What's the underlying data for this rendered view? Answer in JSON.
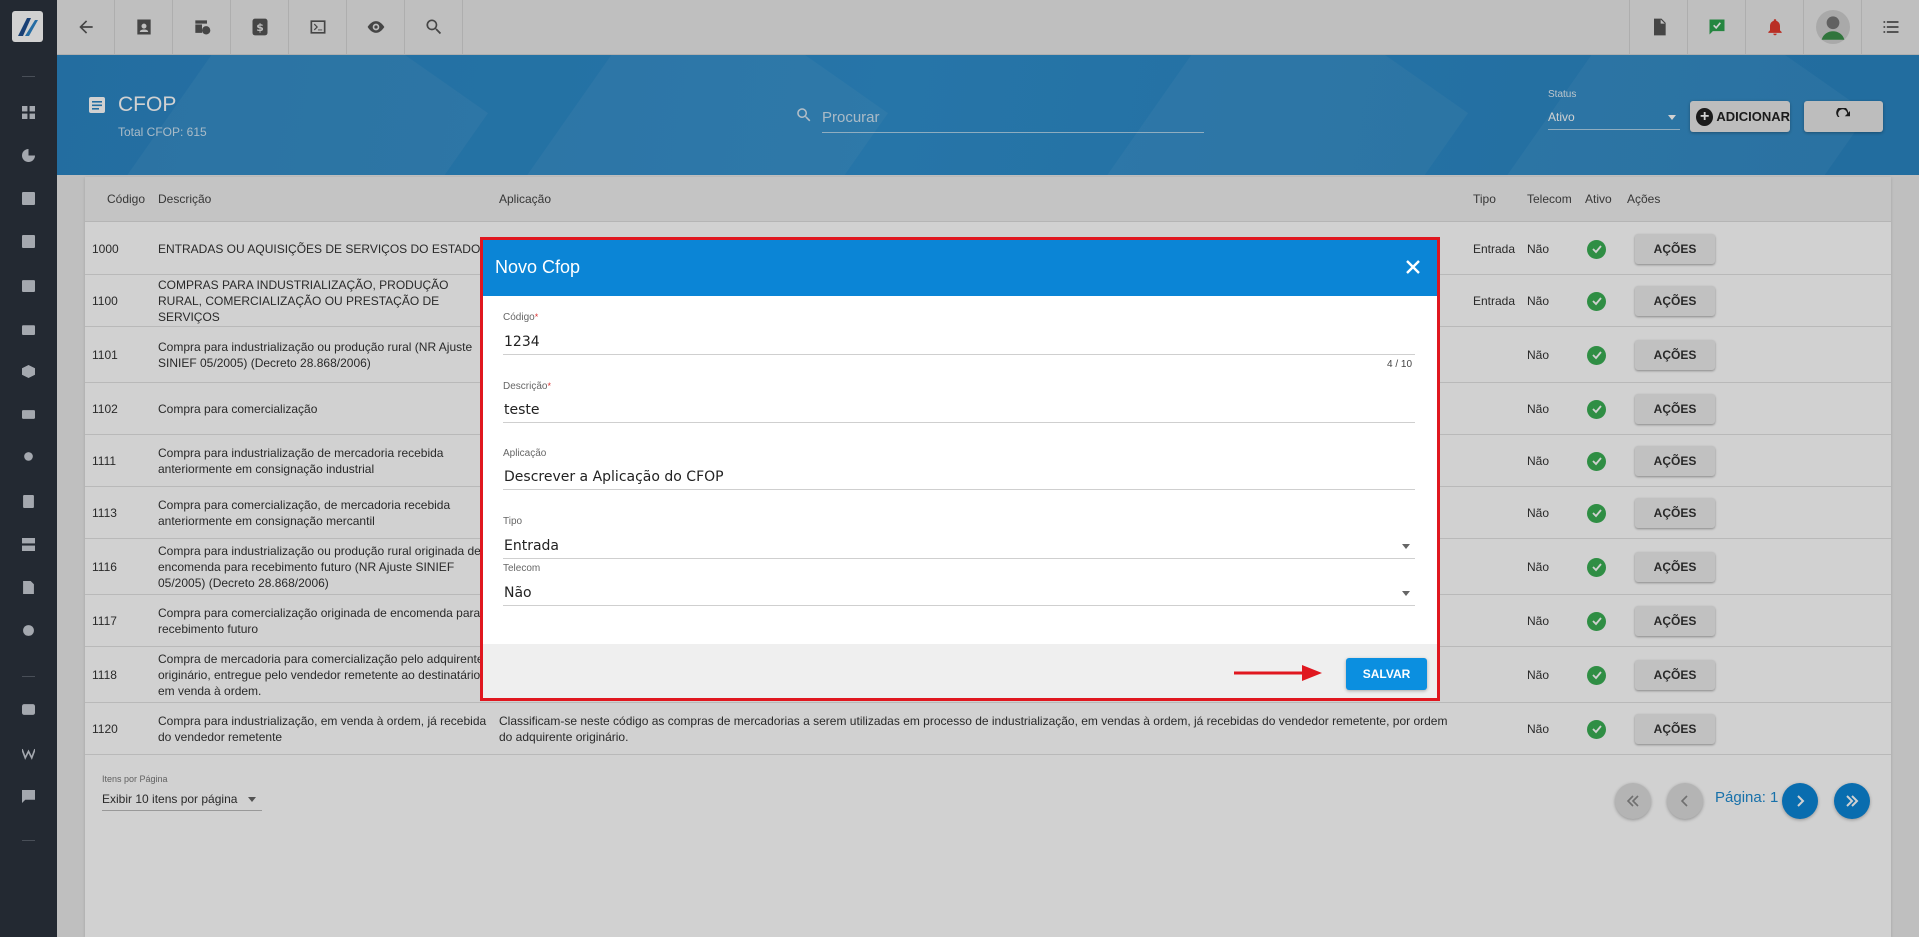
{
  "header": {
    "title": "CFOP",
    "subtitle": "Total CFOP: 615",
    "search_placeholder": "Procurar",
    "status_label": "Status",
    "status_value": "Ativo",
    "add_label": "ADICIONAR"
  },
  "table": {
    "columns": [
      "Código",
      "Descrição",
      "Aplicação",
      "Tipo",
      "Telecom",
      "Ativo",
      "Ações"
    ],
    "rows": [
      {
        "codigo": "1000",
        "descricao": "ENTRADAS OU AQUISIÇÕES DE SERVIÇOS DO ESTADO",
        "aplicacao": "",
        "tipo": "Entrada",
        "telecom": "Não",
        "acoes": "AÇÕES"
      },
      {
        "codigo": "1100",
        "descricao": "COMPRAS PARA INDUSTRIALIZAÇÃO, PRODUÇÃO RURAL, COMERCIALIZAÇÃO OU PRESTAÇÃO DE SERVIÇOS",
        "aplicacao": "",
        "tipo": "Entrada",
        "telecom": "Não",
        "acoes": "AÇÕES"
      },
      {
        "codigo": "1101",
        "descricao": "Compra para industrialização ou produção rural (NR Ajuste SINIEF 05/2005) (Decreto 28.868/2006)",
        "aplicacao": "",
        "tipo": "",
        "telecom": "Não",
        "acoes": "AÇÕES"
      },
      {
        "codigo": "1102",
        "descricao": "Compra para comercialização",
        "aplicacao": "",
        "tipo": "",
        "telecom": "Não",
        "acoes": "AÇÕES"
      },
      {
        "codigo": "1111",
        "descricao": "Compra para industrialização de mercadoria recebida anteriormente em consignação industrial",
        "aplicacao": "",
        "tipo": "",
        "telecom": "Não",
        "acoes": "AÇÕES"
      },
      {
        "codigo": "1113",
        "descricao": "Compra para comercialização, de mercadoria recebida anteriormente em consignação mercantil",
        "aplicacao": "",
        "tipo": "",
        "telecom": "Não",
        "acoes": "AÇÕES"
      },
      {
        "codigo": "1116",
        "descricao": "Compra para industrialização ou produção rural originada de encomenda para recebimento futuro (NR Ajuste SINIEF 05/2005) (Decreto 28.868/2006)",
        "aplicacao": "",
        "tipo": "",
        "telecom": "Não",
        "acoes": "AÇÕES"
      },
      {
        "codigo": "1117",
        "descricao": "Compra para comercialização originada de encomenda para recebimento futuro",
        "aplicacao": "",
        "tipo": "",
        "telecom": "Não",
        "acoes": "AÇÕES"
      },
      {
        "codigo": "1118",
        "descricao": "Compra de mercadoria para comercialização pelo adquirente originário, entregue pelo vendedor remetente ao destinatário, em venda à ordem.",
        "aplicacao": "",
        "tipo": "",
        "telecom": "Não",
        "acoes": "AÇÕES"
      },
      {
        "codigo": "1120",
        "descricao": "Compra para industrialização, em venda à ordem, já recebida do vendedor remetente",
        "aplicacao": "Classificam-se neste código as compras de mercadorias a serem utilizadas em processo de industrialização, em vendas à ordem, já recebidas do vendedor remetente, por ordem do adquirente originário.",
        "tipo": "",
        "telecom": "Não",
        "acoes": "AÇÕES"
      }
    ]
  },
  "pagination": {
    "items_label": "Itens por Página",
    "items_value": "Exibir 10 itens por página",
    "page_label": "Página: 1"
  },
  "modal": {
    "title": "Novo Cfop",
    "codigo_label": "Código",
    "codigo_value": "1234",
    "codigo_counter": "4 / 10",
    "descricao_label": "Descrição",
    "descricao_value": "teste",
    "aplicacao_label": "Aplicação",
    "aplicacao_value": "Descrever a Aplicação do CFOP",
    "tipo_label": "Tipo",
    "tipo_value": "Entrada",
    "telecom_label": "Telecom",
    "telecom_value": "Não",
    "save_label": "SALVAR"
  },
  "colors": {
    "brand_blue": "#0b85d6",
    "header_band": "#2b86c4",
    "sidebar": "#2b323d",
    "active_green": "#3aae54",
    "highlight_red": "#e0171f"
  }
}
